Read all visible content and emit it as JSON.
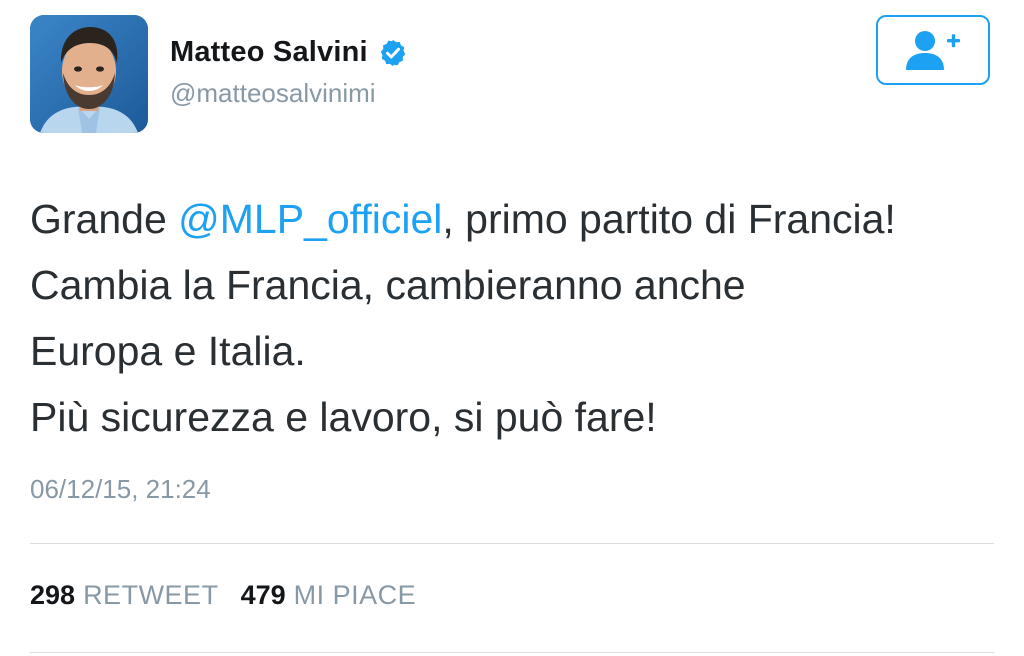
{
  "user": {
    "display_name": "Matteo Salvini",
    "handle": "@matteosalvinimi",
    "verified_icon": "verified-badge-icon",
    "avatar": "profile-photo"
  },
  "follow_button": {
    "icon": "add-user-icon"
  },
  "tweet": {
    "line1_pre": "Grande ",
    "mention": "@MLP_officiel",
    "line1_post": ", primo partito di Francia!",
    "line2": "Cambia la Francia, cambieranno anche",
    "line3": "Europa e Italia.",
    "line4": "Più sicurezza e lavoro, si può fare!"
  },
  "timestamp": "06/12/15, 21:24",
  "stats": {
    "retweet_count": "298",
    "retweet_label": "RETWEET",
    "like_count": "479",
    "like_label": "MI PIACE"
  },
  "colors": {
    "accent": "#1da1f2",
    "text": "#292f33",
    "muted": "#8899a6",
    "divider": "#d9dee2"
  }
}
